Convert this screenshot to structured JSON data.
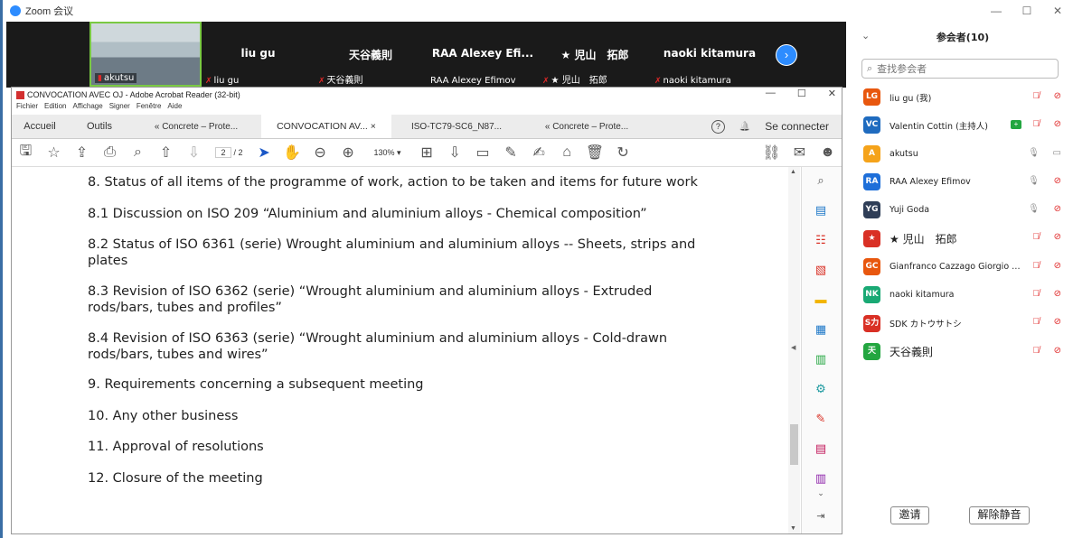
{
  "zoom": {
    "title": "Zoom 会议",
    "window_controls": [
      "—",
      "☐",
      "✕"
    ],
    "video_tiles": [
      {
        "label": "akutsu",
        "has_camera": true
      },
      {
        "name": "liu gu",
        "label": "liu gu"
      },
      {
        "name": "天谷義則",
        "label": "天谷義則"
      },
      {
        "name": "RAA Alexey Efi...",
        "label": "RAA Alexey Efimov"
      },
      {
        "name": "★  児山　拓郎",
        "label": "★  児山　拓郎"
      },
      {
        "name": "naoki kitamura",
        "label": "naoki kitamura"
      }
    ],
    "next_icon": "chevron-right-icon"
  },
  "acrobat": {
    "title": "CONVOCATION AVEC OJ - Adobe Acrobat Reader (32-bit)",
    "window_controls": [
      "—",
      "☐",
      "✕"
    ],
    "menu": [
      "Fichier",
      "Edition",
      "Affichage",
      "Signer",
      "Fenêtre",
      "Aide"
    ],
    "tabs": {
      "home": "Accueil",
      "tools": "Outils",
      "docs": [
        "« Concrete – Prote...",
        "CONVOCATION AV... ×",
        "ISO-TC79-SC6_N87...",
        "« Concrete – Prote..."
      ],
      "help": "?",
      "bell": "🔔",
      "connect": "Se connecter"
    },
    "page_current": "2",
    "page_total": "/ 2",
    "zoom": "130%",
    "document_lines": [
      "8. Status of all items of the programme of work, action to be taken and items for future work",
      "8.1 Discussion on ISO 209 “Aluminium and aluminium alloys - Chemical composition”",
      "8.2 Status of ISO 6361 (serie) Wrought aluminium and aluminium alloys -- Sheets, strips and",
      "plates",
      "8.3 Revision of ISO 6362 (serie) “Wrought aluminium and aluminium alloys - Extruded",
      "rods/bars, tubes and profiles”",
      "8.4 Revision of ISO 6363 (serie) “Wrought aluminium and aluminium alloys - Cold-drawn",
      "rods/bars, tubes and wires”",
      "9. Requirements concerning a subsequent meeting",
      "10. Any other business",
      "11. Approval of resolutions",
      "12. Closure of the meeting"
    ]
  },
  "participants": {
    "title": "参会者(10)",
    "search_placeholder": "查找参会者",
    "list": [
      {
        "initials": "LG",
        "name": "liu gu (我)",
        "color": "#e8570e",
        "mic": "muted",
        "cam": "off"
      },
      {
        "initials": "VC",
        "name": "Valentin Cottin (主持人)",
        "color": "#1f6bbf",
        "mic": "muted",
        "cam": "off",
        "host": true
      },
      {
        "initials": "A",
        "name": "akutsu",
        "color": "#f5a31a",
        "mic": "on",
        "cam": "on"
      },
      {
        "initials": "RA",
        "name": "RAA Alexey Efimov",
        "color": "#1e6fd9",
        "mic": "on",
        "cam": "off"
      },
      {
        "initials": "YG",
        "name": "Yuji Goda",
        "color": "#2f3e57",
        "mic": "on",
        "cam": "off"
      },
      {
        "initials": "★",
        "name": "★  児山　拓郎",
        "color": "#d93025",
        "mic": "muted",
        "cam": "off",
        "big": true
      },
      {
        "initials": "GC",
        "name": "Gianfranco Cazzago Giorgio Di ...",
        "color": "#e8570e",
        "mic": "muted",
        "cam": "off"
      },
      {
        "initials": "NK",
        "name": "naoki kitamura",
        "color": "#19a974",
        "mic": "muted",
        "cam": "off"
      },
      {
        "initials": "S力",
        "name": "SDK カトウサトシ",
        "color": "#d93025",
        "mic": "muted",
        "cam": "off"
      },
      {
        "initials": "天",
        "name": "天谷義則",
        "color": "#23a640",
        "mic": "muted",
        "cam": "off",
        "big": true
      }
    ],
    "invite": "邀请",
    "unmute": "解除静音"
  }
}
